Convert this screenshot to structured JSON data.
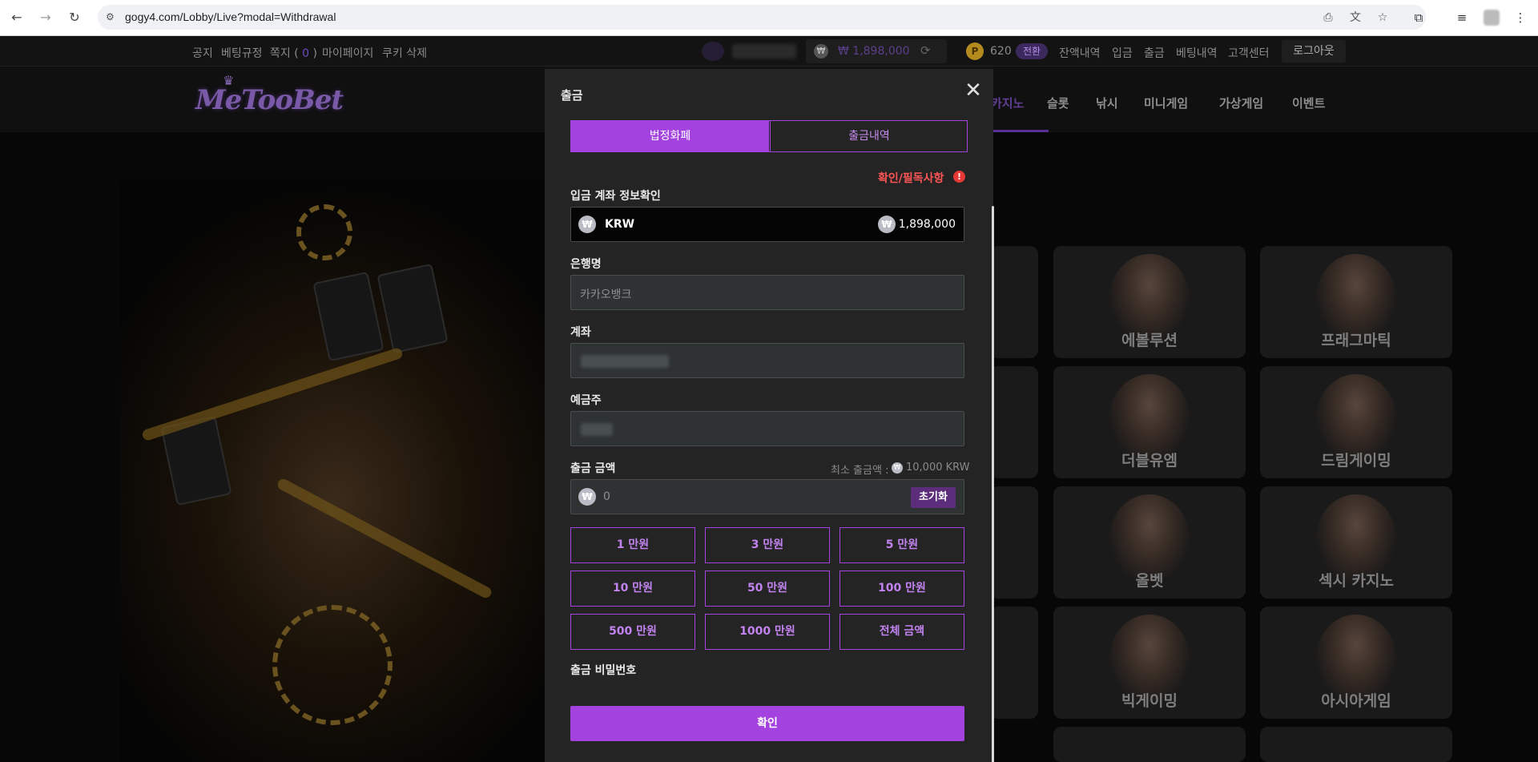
{
  "browser": {
    "url": "gogy4.com/Lobby/Live?modal=Withdrawal"
  },
  "topbar": {
    "links": [
      "공지",
      "베팅규정",
      "마이페이지",
      "쿠키 삭제"
    ],
    "messages_label": "쪽지 (",
    "messages_count": "0",
    "messages_close": ")",
    "balance": "₩ 1,898,000",
    "points": "620",
    "convert_label": "전환",
    "right_links": [
      "잔액내역",
      "입금",
      "출금",
      "베팅내역",
      "고객센터"
    ],
    "logout_label": "로그아웃"
  },
  "header": {
    "logo": "MeTooBet",
    "nav": [
      "카지노",
      "슬롯",
      "낚시",
      "미니게임",
      "가상게임",
      "이벤트"
    ]
  },
  "tiles": [
    "에볼루션",
    "프래그마틱",
    "더블유엠",
    "드림게이밍",
    "올벳",
    "섹시 카지노",
    "빅게이밍",
    "아시아게임"
  ],
  "modal": {
    "title": "출금",
    "tabs": [
      "법정화폐",
      "출금내역"
    ],
    "notice": "확인/필독사항",
    "account_info_label": "입금 계좌 정보확인",
    "currency": "KRW",
    "currency_balance": "1,898,000",
    "bank_label": "은행명",
    "bank_placeholder": "카카오뱅크",
    "account_label": "계좌",
    "holder_label": "예금주",
    "amount_label": "출금 금액",
    "min_label": "최소 출금액 :",
    "min_value": "10,000 KRW",
    "amount_placeholder": "0",
    "reset_label": "초기화",
    "amount_buttons": [
      "1 만원",
      "3 만원",
      "5 만원",
      "10 만원",
      "50 만원",
      "100 만원",
      "500 만원",
      "1000 만원",
      "전체 금액"
    ],
    "password_label": "출금 비밀번호",
    "confirm_label": "확인"
  },
  "colors": {
    "accent": "#a442df",
    "accent_text": "#c283f0",
    "notice": "#ff5555"
  }
}
